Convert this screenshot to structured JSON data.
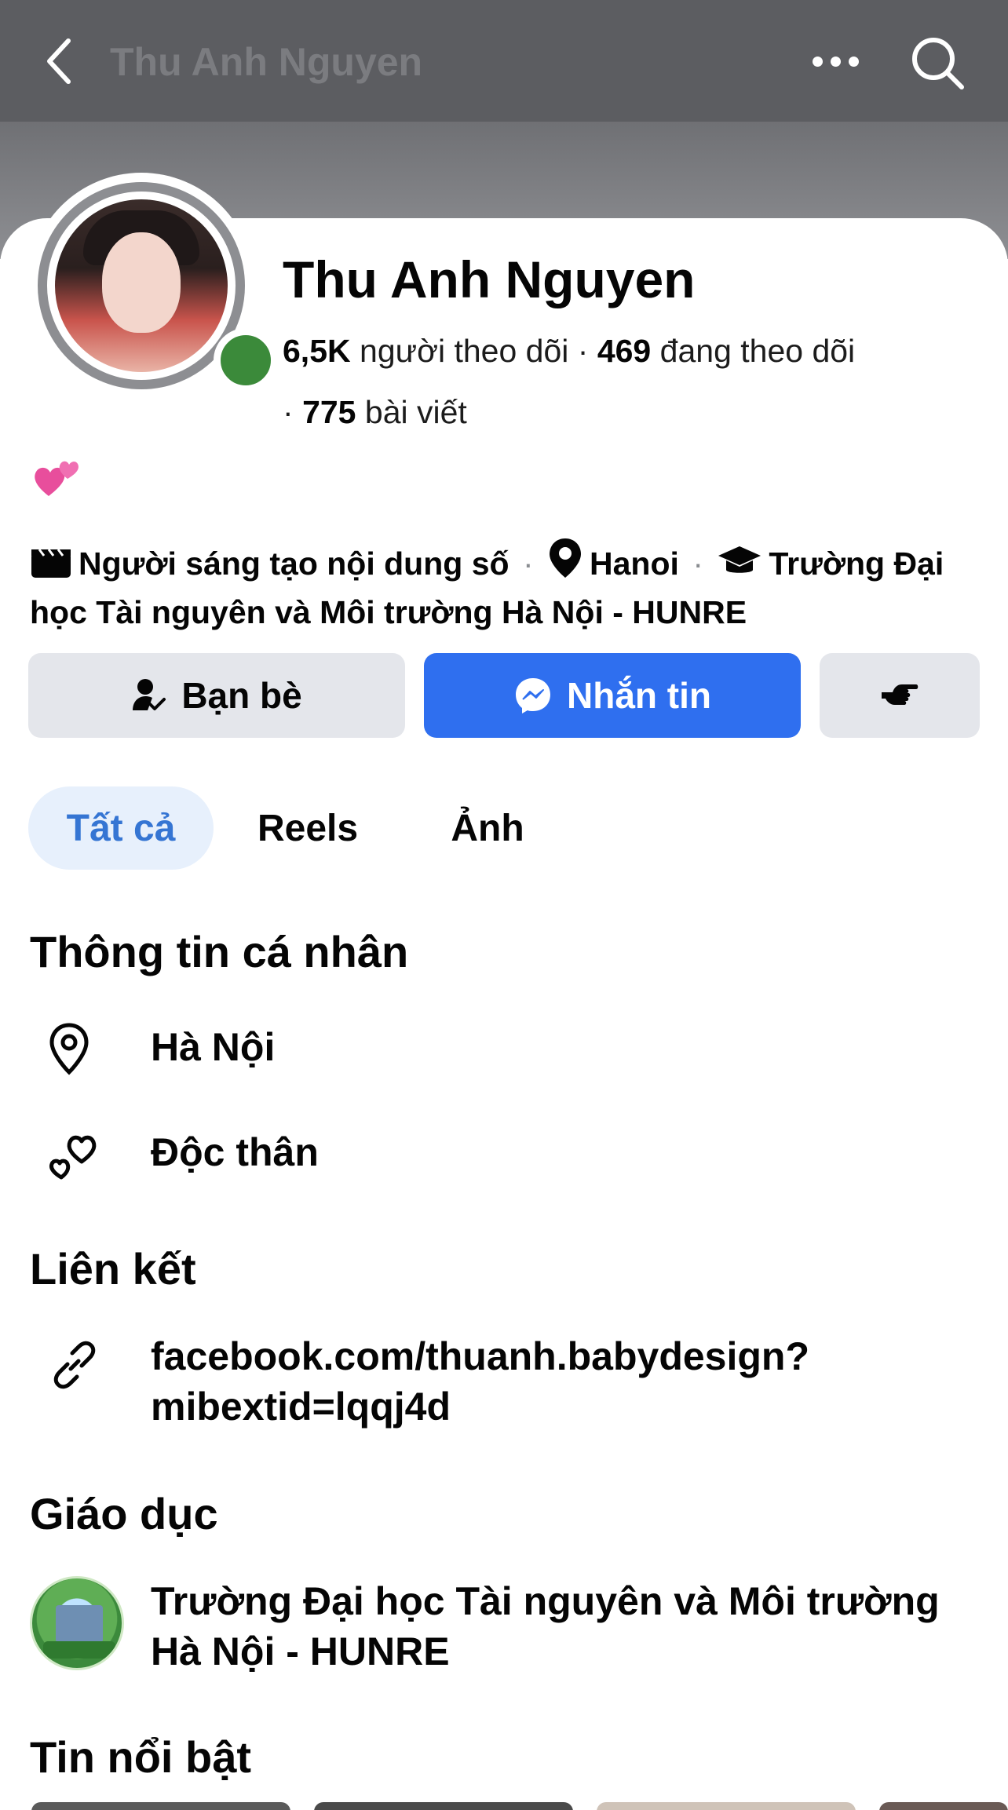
{
  "header": {
    "title": "Thu Anh Nguyen",
    "back_icon": "chevron-left-icon",
    "more_icon": "more-horizontal-icon",
    "search_icon": "search-icon"
  },
  "profile": {
    "name": "Thu Anh Nguyen",
    "online": true,
    "followers_count": "6,5K",
    "followers_label": "người theo dõi",
    "following_count": "469",
    "following_label": "đang theo dõi",
    "posts_count": "775",
    "posts_label": "bài viết",
    "bio": "💕"
  },
  "details": {
    "creator": "Người sáng tạo nội dung số",
    "location": "Hanoi",
    "school": "Trường Đại học Tài nguyên và Môi trường Hà Nội - HUNRE",
    "separator": "·"
  },
  "actions": {
    "friends_label": "Bạn bè",
    "message_label": "Nhắn tin"
  },
  "tabs": [
    {
      "label": "Tất cả",
      "active": true
    },
    {
      "label": "Reels",
      "active": false
    },
    {
      "label": "Ảnh",
      "active": false
    }
  ],
  "personal_info": {
    "title": "Thông tin cá nhân",
    "city": "Hà Nội",
    "relationship": "Độc thân"
  },
  "links": {
    "title": "Liên kết",
    "url_line1": "facebook.com/thuanh.babydesign?",
    "url_line2": "mibextid=lqqj4d"
  },
  "education": {
    "title": "Giáo dục",
    "school_line1": "Trường Đại học Tài nguyên và Môi trường",
    "school_line2": "Hà Nội - HUNRE"
  },
  "featured": {
    "title": "Tin nổi bật"
  },
  "colors": {
    "accent": "#2f6fef",
    "active_tab_bg": "#e7f0fc",
    "active_tab_text": "#3575d3",
    "button_gray": "#e4e6eb",
    "online_green": "#3b8a3a"
  }
}
